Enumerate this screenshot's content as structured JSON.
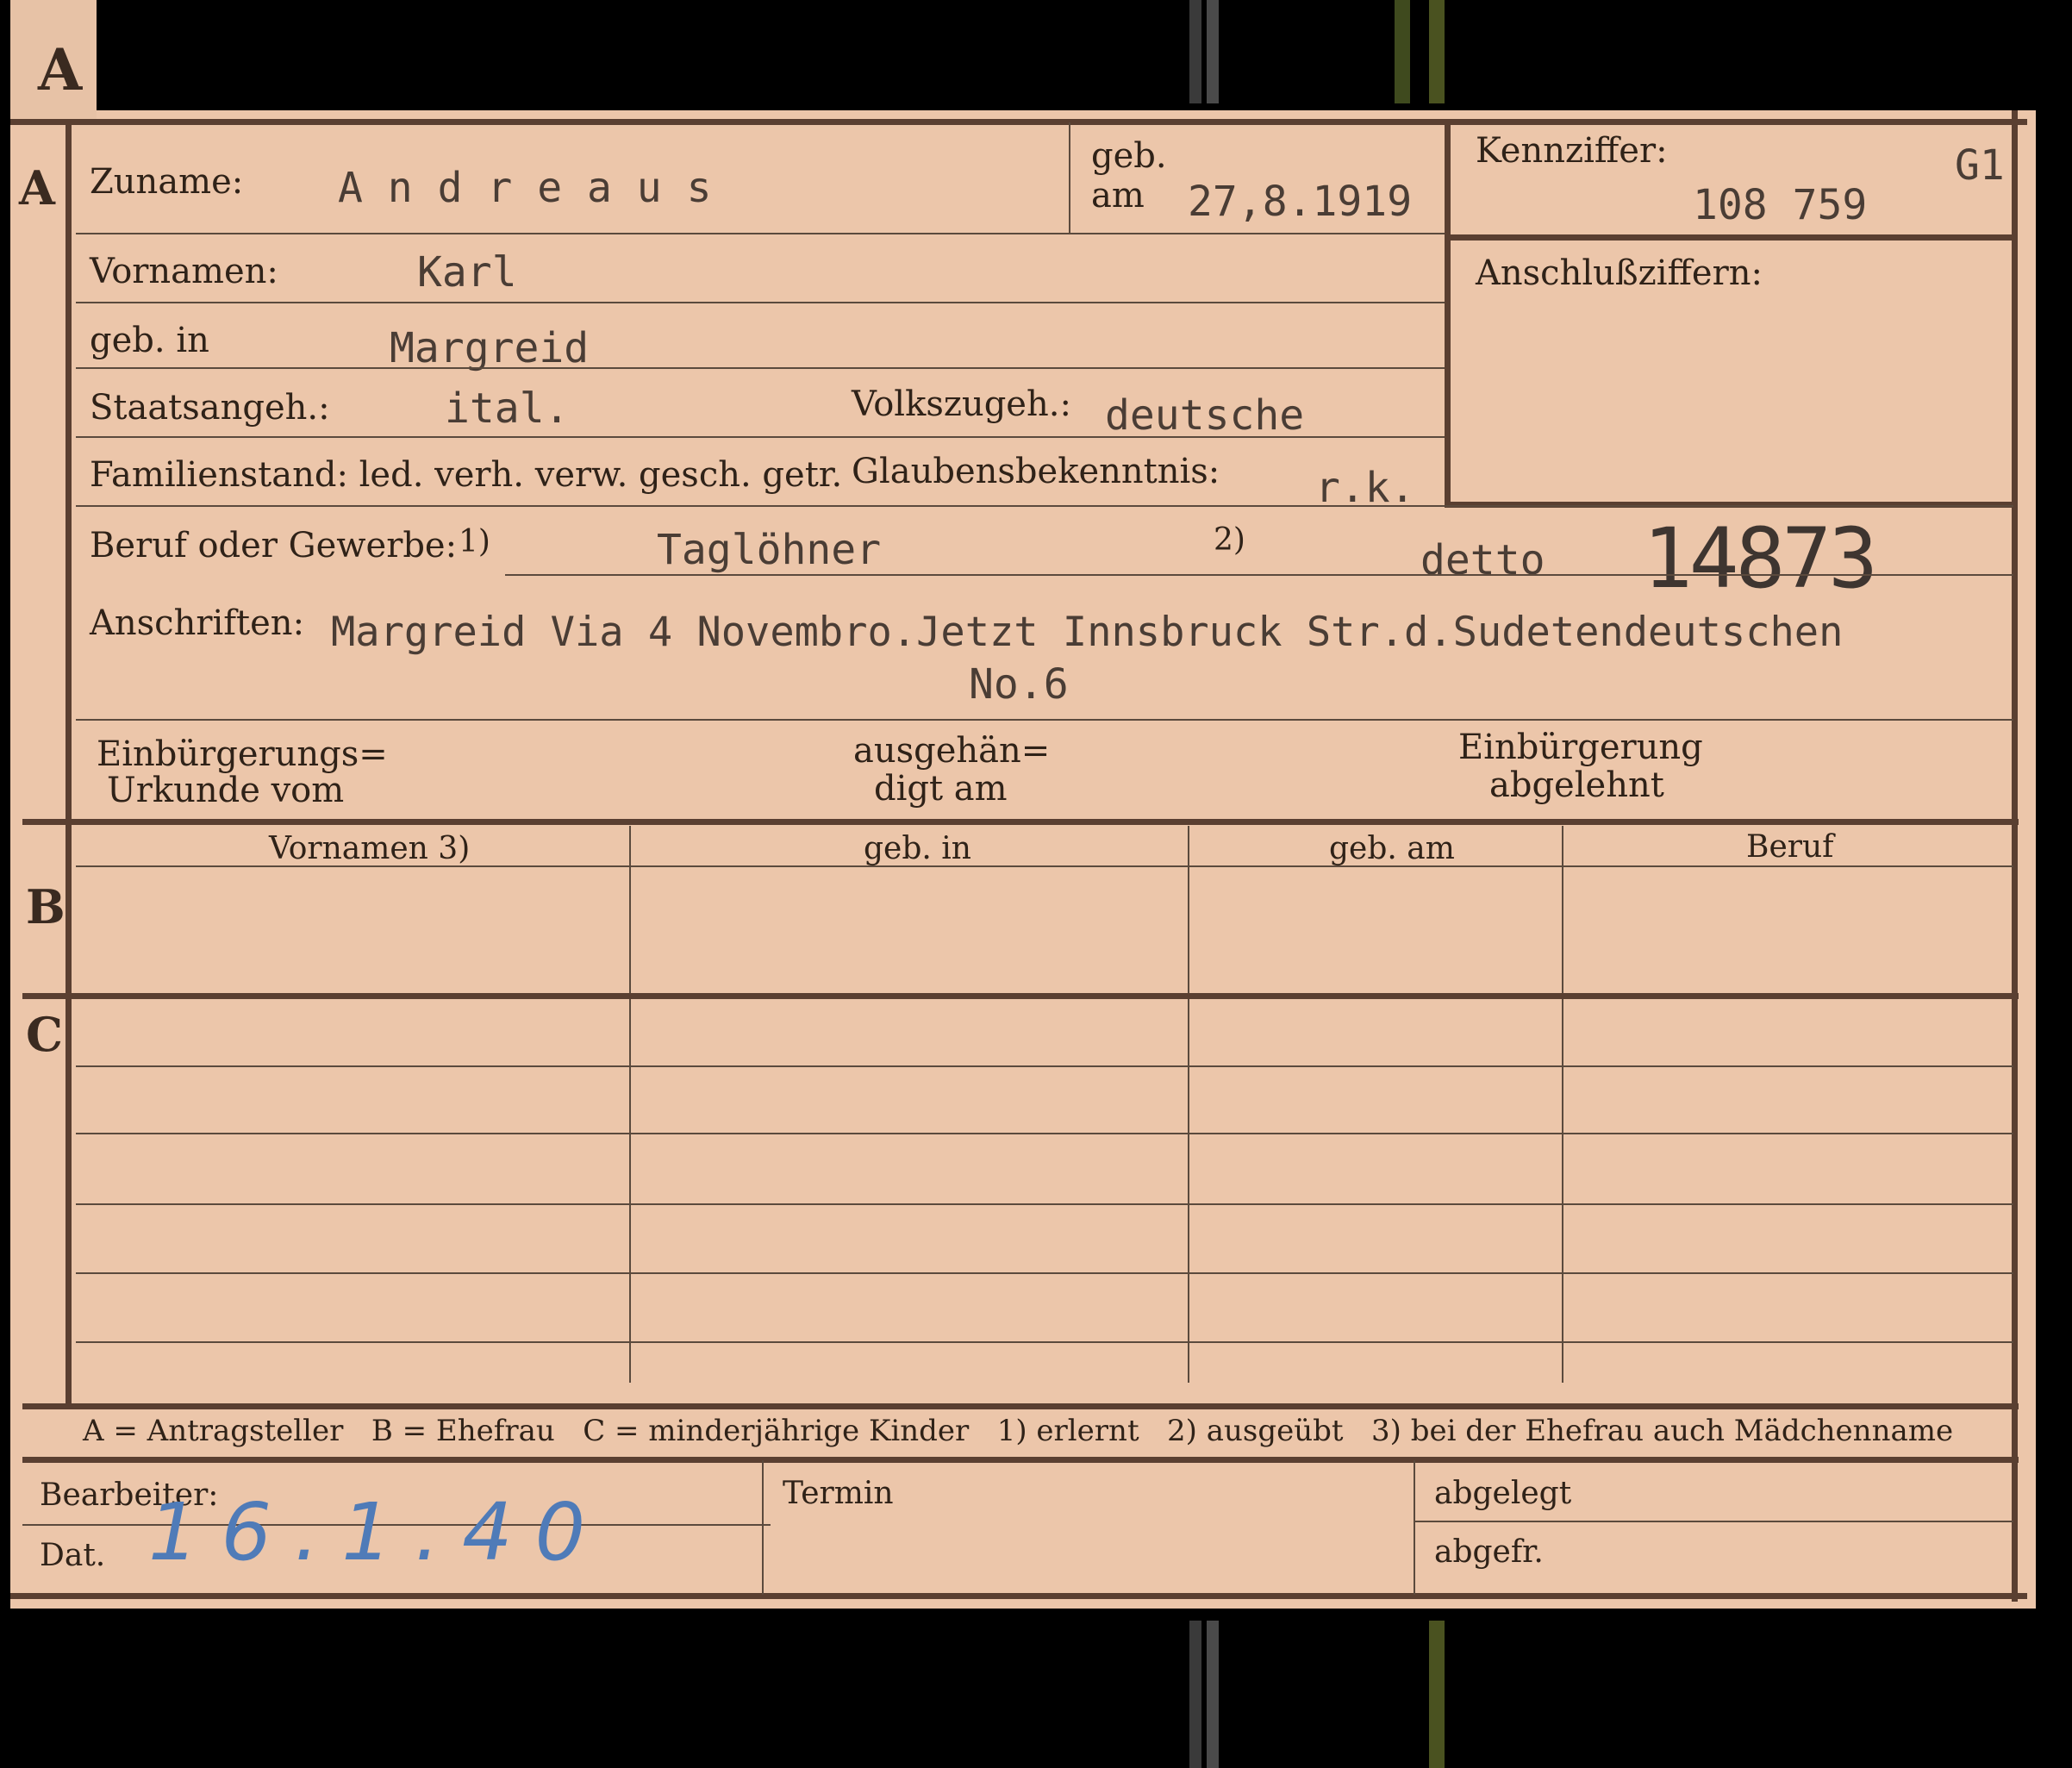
{
  "tab": {
    "letter": "A"
  },
  "section_a": {
    "letter": "A",
    "zuname_label": "Zuname:",
    "zuname_value": "A n d r e a u s",
    "geb_am_label_1": "geb.",
    "geb_am_label_2": "am",
    "geb_am_value": "27,8.1919",
    "kennziffer_label": "Kennziffer:",
    "kennziffer_code": "G1",
    "kennziffer_value": "108 759",
    "anschluss_label": "Anschlußziffern:",
    "vornamen_label": "Vornamen:",
    "vornamen_value": "Karl",
    "geb_in_label": "geb. in",
    "geb_in_value": "Margreid",
    "staatsangeh_label": "Staatsangeh.:",
    "staatsangeh_value": "ital.",
    "volkszugeh_label": "Volkszugeh.:",
    "volkszugeh_value": "deutsche",
    "familienstand_label": "Familienstand: led. verh. verw. gesch. getr.",
    "glaubens_label": "Glaubensbekenntnis:",
    "glaubens_value": "r.k.",
    "beruf_label": "Beruf oder Gewerbe:",
    "beruf_note1": "1)",
    "beruf_value": "Taglöhner",
    "beruf_note2": "2)",
    "beruf_value2": "detto",
    "stamp_number": "14873",
    "anschriften_label": "Anschriften:",
    "anschriften_line1": "Margreid Via 4 Novembro.Jetzt Innsbruck Str.d.Sudetendeutschen",
    "anschriften_line2": "No.6",
    "einbuerg_label_1": "Einbürgerungs=",
    "einbuerg_label_2": "Urkunde vom",
    "ausgehaen_label_1": "ausgehän=",
    "ausgehaen_label_2": "digt am",
    "abgelehnt_label_1": "Einbürgerung",
    "abgelehnt_label_2": "abgelehnt"
  },
  "section_b": {
    "letter": "B",
    "headers": [
      "Vornamen 3)",
      "geb. in",
      "geb. am",
      "Beruf"
    ]
  },
  "section_c": {
    "letter": "C"
  },
  "legend": "A = Antragsteller   B = Ehefrau   C = minderjährige Kinder   1) erlernt   2) ausgeübt   3) bei der Ehefrau auch Mädchenname",
  "footer": {
    "bearbeiter_label": "Bearbeiter:",
    "dat_label": "Dat.",
    "dat_value": "16.1.40",
    "termin_label": "Termin",
    "abgelegt_label": "abgelegt",
    "abgefr_label": "abgefr."
  }
}
